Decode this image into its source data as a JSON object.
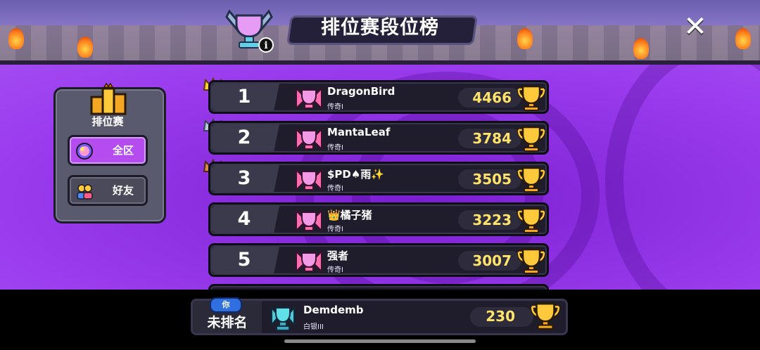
{
  "header": {
    "title": "排位赛段位榜",
    "close_glyph": "✕"
  },
  "sidebar": {
    "label": "排位赛",
    "tabs": [
      {
        "label": "全区",
        "selected": true,
        "icon": "globe-icon"
      },
      {
        "label": "好友",
        "selected": false,
        "icon": "friends-icon"
      }
    ]
  },
  "leaderboard": [
    {
      "rank": "1",
      "name": "DragonBird",
      "tier": "传奇I",
      "score": "4466",
      "crown": "gold"
    },
    {
      "rank": "2",
      "name": "MantaLeaf",
      "tier": "传奇I",
      "score": "3784",
      "crown": "silver"
    },
    {
      "rank": "3",
      "name": "$PD♠雨✨",
      "tier": "传奇I",
      "score": "3505",
      "crown": "bronze"
    },
    {
      "rank": "4",
      "name": "👑橘子猪",
      "tier": "传奇I",
      "score": "3223"
    },
    {
      "rank": "5",
      "name": "强者",
      "tier": "传奇I",
      "score": "3007"
    }
  ],
  "me": {
    "you_badge": "你",
    "rank_text": "未排名",
    "name": "Demdemb",
    "tier": "白银III",
    "score": "230"
  },
  "colors": {
    "accent_purple": "#9a3cee",
    "score_yellow": "#ffe36a",
    "row_bg": "#1f1d2b"
  }
}
